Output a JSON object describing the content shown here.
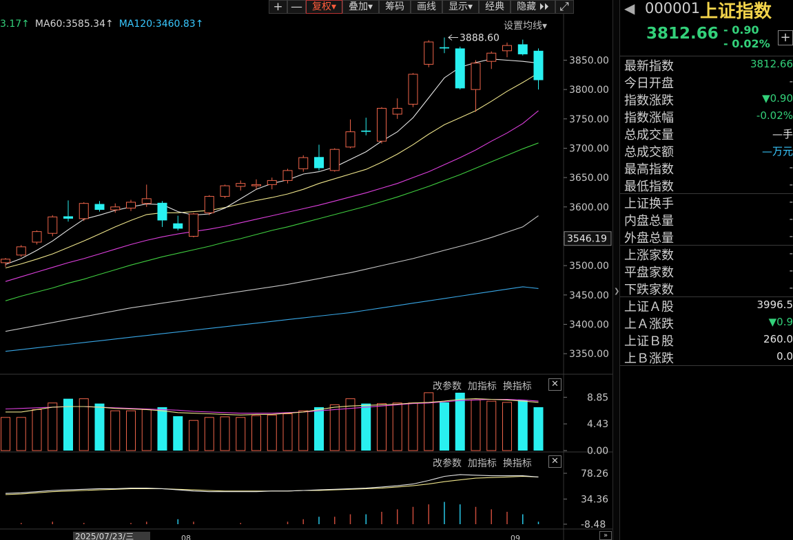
{
  "toolbar": {
    "items": [
      {
        "label": "+",
        "kind": "square"
      },
      {
        "label": "—",
        "kind": "square"
      },
      {
        "label": "复权▾",
        "kind": "text",
        "active": true
      },
      {
        "label": "叠加▾",
        "kind": "text"
      },
      {
        "label": "筹码",
        "kind": "text"
      },
      {
        "label": "画线",
        "kind": "text"
      },
      {
        "label": "显示▾",
        "kind": "text"
      },
      {
        "label": "经典",
        "kind": "text"
      },
      {
        "label": "隐藏 ⏵⏵",
        "kind": "text"
      },
      {
        "label": "⤢",
        "kind": "square"
      }
    ]
  },
  "ma_legend": [
    {
      "text": "3.17↑",
      "color": "#33d17a"
    },
    {
      "text": "MA60:3585.34↑",
      "color": "#d6d6d6"
    },
    {
      "text": "MA120:3460.83↑",
      "color": "#39c8ff"
    }
  ],
  "ma_settings_label": "设置均线▾",
  "colors": {
    "up": "#f0654a",
    "down": "#29f0f0",
    "ma5": "#e8e8e8",
    "ma10": "#f0e68c",
    "ma20": "#e040e0",
    "ma30": "#40d040",
    "ma60": "#c8c8c8",
    "ma120": "#39a8e8",
    "vol_ma5": "#f0e68c",
    "vol_ma10": "#e040e0",
    "background": "#000000",
    "grid": "#222222"
  },
  "chart_data": [
    {
      "type": "candlestick",
      "title": "上证指数",
      "ylim": [
        3315,
        3915
      ],
      "y_ticks": [
        "3850.00",
        "3800.00",
        "3750.00",
        "3700.00",
        "3650.00",
        "3600.00",
        "3550.00",
        "3500.00",
        "3450.00",
        "3400.00",
        "3350.00"
      ],
      "price_tag": "3546.19",
      "max_annotation": "3888.60",
      "candles": [
        {
          "o": 3505,
          "h": 3513,
          "l": 3498,
          "c": 3511
        },
        {
          "o": 3518,
          "h": 3535,
          "l": 3515,
          "c": 3532
        },
        {
          "o": 3540,
          "h": 3560,
          "l": 3536,
          "c": 3558
        },
        {
          "o": 3555,
          "h": 3586,
          "l": 3550,
          "c": 3583
        },
        {
          "o": 3584,
          "h": 3611,
          "l": 3575,
          "c": 3580
        },
        {
          "o": 3580,
          "h": 3608,
          "l": 3576,
          "c": 3606
        },
        {
          "o": 3605,
          "h": 3610,
          "l": 3592,
          "c": 3595
        },
        {
          "o": 3595,
          "h": 3606,
          "l": 3590,
          "c": 3600
        },
        {
          "o": 3598,
          "h": 3612,
          "l": 3593,
          "c": 3608
        },
        {
          "o": 3606,
          "h": 3638,
          "l": 3600,
          "c": 3614
        },
        {
          "o": 3607,
          "h": 3610,
          "l": 3566,
          "c": 3577
        },
        {
          "o": 3572,
          "h": 3585,
          "l": 3560,
          "c": 3563
        },
        {
          "o": 3550,
          "h": 3590,
          "l": 3548,
          "c": 3588
        },
        {
          "o": 3590,
          "h": 3620,
          "l": 3586,
          "c": 3618
        },
        {
          "o": 3618,
          "h": 3638,
          "l": 3615,
          "c": 3636
        },
        {
          "o": 3635,
          "h": 3645,
          "l": 3628,
          "c": 3640
        },
        {
          "o": 3636,
          "h": 3647,
          "l": 3630,
          "c": 3638
        },
        {
          "o": 3638,
          "h": 3650,
          "l": 3630,
          "c": 3645
        },
        {
          "o": 3645,
          "h": 3665,
          "l": 3640,
          "c": 3662
        },
        {
          "o": 3665,
          "h": 3688,
          "l": 3660,
          "c": 3684
        },
        {
          "o": 3685,
          "h": 3706,
          "l": 3662,
          "c": 3666
        },
        {
          "o": 3662,
          "h": 3700,
          "l": 3660,
          "c": 3698
        },
        {
          "o": 3702,
          "h": 3749,
          "l": 3700,
          "c": 3728
        },
        {
          "o": 3730,
          "h": 3752,
          "l": 3722,
          "c": 3728
        },
        {
          "o": 3712,
          "h": 3770,
          "l": 3708,
          "c": 3768
        },
        {
          "o": 3758,
          "h": 3785,
          "l": 3750,
          "c": 3768
        },
        {
          "o": 3775,
          "h": 3828,
          "l": 3770,
          "c": 3826
        },
        {
          "o": 3843,
          "h": 3884,
          "l": 3838,
          "c": 3881
        },
        {
          "o": 3872,
          "h": 3888.6,
          "l": 3862,
          "c": 3870
        },
        {
          "o": 3870,
          "h": 3873,
          "l": 3800,
          "c": 3802
        },
        {
          "o": 3800,
          "h": 3850,
          "l": 3762,
          "c": 3845
        },
        {
          "o": 3848,
          "h": 3865,
          "l": 3835,
          "c": 3862
        },
        {
          "o": 3866,
          "h": 3880,
          "l": 3855,
          "c": 3875
        },
        {
          "o": 3877,
          "h": 3885,
          "l": 3858,
          "c": 3860
        },
        {
          "o": 3866,
          "h": 3870,
          "l": 3800,
          "c": 3816
        }
      ],
      "ma5": [
        3502,
        3512,
        3526,
        3542,
        3561,
        3579,
        3586,
        3594,
        3600,
        3605,
        3604,
        3592,
        3586,
        3588,
        3598,
        3614,
        3630,
        3640,
        3646,
        3656,
        3660,
        3668,
        3681,
        3694,
        3712,
        3728,
        3752,
        3786,
        3820,
        3838,
        3846,
        3852,
        3850,
        3848,
        3845
      ],
      "ma10": [
        3496,
        3503,
        3511,
        3520,
        3531,
        3542,
        3554,
        3566,
        3577,
        3587,
        3590,
        3590,
        3592,
        3594,
        3599,
        3605,
        3611,
        3616,
        3622,
        3630,
        3640,
        3648,
        3656,
        3664,
        3676,
        3690,
        3706,
        3724,
        3740,
        3752,
        3764,
        3780,
        3797,
        3812,
        3828
      ],
      "ma20": [
        3473,
        3481,
        3489,
        3497,
        3505,
        3512,
        3520,
        3528,
        3536,
        3543,
        3549,
        3554,
        3558,
        3562,
        3567,
        3573,
        3579,
        3585,
        3591,
        3597,
        3603,
        3610,
        3617,
        3624,
        3632,
        3640,
        3650,
        3660,
        3672,
        3684,
        3697,
        3712,
        3726,
        3742,
        3764
      ],
      "ma30": [
        3440,
        3448,
        3455,
        3462,
        3470,
        3477,
        3485,
        3493,
        3501,
        3508,
        3515,
        3521,
        3527,
        3533,
        3540,
        3546,
        3553,
        3560,
        3566,
        3573,
        3580,
        3587,
        3594,
        3601,
        3609,
        3617,
        3626,
        3635,
        3645,
        3655,
        3666,
        3677,
        3688,
        3699,
        3709
      ],
      "ma60": [
        3388,
        3393,
        3398,
        3403,
        3408,
        3413,
        3418,
        3423,
        3428,
        3432,
        3436,
        3440,
        3444,
        3448,
        3452,
        3456,
        3460,
        3464,
        3468,
        3473,
        3478,
        3483,
        3488,
        3494,
        3500,
        3506,
        3512,
        3519,
        3526,
        3533,
        3540,
        3548,
        3557,
        3566,
        3585
      ],
      "ma120": [
        3354,
        3357,
        3360,
        3363,
        3366,
        3369,
        3372,
        3375,
        3378,
        3381,
        3384,
        3387,
        3390,
        3393,
        3396,
        3399,
        3402,
        3405,
        3408,
        3411,
        3414,
        3417,
        3420,
        3424,
        3428,
        3432,
        3436,
        3440,
        3444,
        3448,
        3452,
        3456,
        3460,
        3464,
        3461
      ]
    },
    {
      "type": "bar",
      "title": "volume",
      "ylim": [
        0,
        9.7
      ],
      "y_ticks": [
        "8.85",
        "4.43",
        "0.00"
      ],
      "volume": [
        5.5,
        5.5,
        6.8,
        7.9,
        8.6,
        8.6,
        7.8,
        6.6,
        6.6,
        6.8,
        7.2,
        5.7,
        5.0,
        5.5,
        5.6,
        5.5,
        5.8,
        5.9,
        6.1,
        6.6,
        7.2,
        7.6,
        8.6,
        7.8,
        7.8,
        7.9,
        7.9,
        9.6,
        8.0,
        9.6,
        8.4,
        8.2,
        8.0,
        8.4,
        7.2
      ],
      "vol_ma5": [
        6.4,
        6.4,
        6.8,
        7.2,
        7.3,
        7.3,
        7.2,
        7.0,
        6.9,
        6.8,
        6.6,
        6.3,
        6.2,
        6.1,
        6.0,
        5.9,
        6.0,
        6.0,
        6.2,
        6.4,
        6.8,
        7.2,
        7.4,
        7.5,
        7.6,
        7.7,
        7.9,
        8.0,
        8.2,
        8.5,
        8.6,
        8.5,
        8.4,
        8.2,
        8.0
      ],
      "vol_ma10": [
        6.9,
        7.0,
        7.1,
        7.2,
        7.3,
        7.3,
        7.2,
        7.1,
        7.0,
        6.9,
        6.8,
        6.7,
        6.5,
        6.4,
        6.3,
        6.2,
        6.2,
        6.2,
        6.3,
        6.4,
        6.6,
        6.8,
        7.0,
        7.2,
        7.4,
        7.6,
        7.8,
        7.9,
        8.1,
        8.3,
        8.4,
        8.5,
        8.5,
        8.4,
        8.2
      ],
      "controls": [
        "改参数",
        "加指标",
        "换指标"
      ]
    },
    {
      "type": "line",
      "title": "indicator",
      "ylim": [
        -8.48,
        90
      ],
      "y_ticks": [
        "78.26",
        "34.36",
        "-8.48"
      ],
      "line1": [
        44,
        45,
        47,
        49,
        50,
        51,
        52,
        52,
        53,
        53,
        52,
        50,
        48,
        47,
        47,
        47,
        47,
        48,
        48,
        49,
        50,
        51,
        52,
        53,
        55,
        57,
        60,
        66,
        73,
        76,
        75,
        74,
        74,
        74,
        72
      ],
      "line2": [
        42,
        43,
        45,
        47,
        48,
        49,
        50,
        51,
        52,
        52,
        52,
        51,
        50,
        49,
        48,
        48,
        48,
        48,
        48,
        49,
        49,
        50,
        51,
        52,
        53,
        55,
        57,
        60,
        64,
        67,
        70,
        71,
        72,
        73,
        72
      ],
      "bars": [
        0,
        0.5,
        0,
        1,
        0,
        0.5,
        0,
        0,
        0.5,
        1,
        0,
        2,
        1,
        0,
        0,
        0.5,
        0,
        0,
        1,
        2,
        3,
        3,
        4,
        4,
        5,
        6,
        7,
        8,
        9,
        8,
        7,
        6,
        5,
        4,
        1
      ],
      "controls": [
        "改参数",
        "加指标",
        "换指标"
      ]
    }
  ],
  "x_axis": {
    "date_label": "2025/07/23/三",
    "ticks": [
      "08",
      "09"
    ]
  },
  "info_panel": {
    "code": "000001",
    "name": "上证指数",
    "price": "3812.66",
    "change": "- 0.90",
    "change_pct": "- 0.02%",
    "plus": "+",
    "groups": [
      [
        {
          "label": "最新指数",
          "value": "3812.66",
          "color": "green"
        },
        {
          "label": "今日开盘",
          "value": "-",
          "color": "gray"
        },
        {
          "label": "指数涨跌",
          "value": "▼0.90",
          "color": "green"
        },
        {
          "label": "指数涨幅",
          "value": "-0.02%",
          "color": "green"
        },
        {
          "label": "总成交量",
          "value": "—手",
          "color": "white"
        },
        {
          "label": "总成交额",
          "value": "—万元",
          "color": "cyan"
        },
        {
          "label": "最高指数",
          "value": "-",
          "color": "gray"
        },
        {
          "label": "最低指数",
          "value": "-",
          "color": "gray"
        }
      ],
      [
        {
          "label": "上证换手",
          "value": "-",
          "color": "gray"
        },
        {
          "label": "内盘总量",
          "value": "-",
          "color": "gray"
        },
        {
          "label": "外盘总量",
          "value": "-",
          "color": "gray"
        }
      ],
      [
        {
          "label": "上涨家数",
          "value": "-",
          "color": "gray"
        },
        {
          "label": "平盘家数",
          "value": "-",
          "color": "gray"
        },
        {
          "label": "下跌家数",
          "value": "-",
          "color": "gray"
        }
      ],
      [
        {
          "label": "上证Ａ股",
          "value": "3996.5",
          "color": "white"
        },
        {
          "label": "上Ａ涨跌",
          "value": "▼0.9",
          "color": "green"
        },
        {
          "label": "上证Ｂ股",
          "value": "260.0",
          "color": "white"
        },
        {
          "label": "上Ｂ涨跌",
          "value": "0.0",
          "color": "white"
        }
      ]
    ]
  }
}
